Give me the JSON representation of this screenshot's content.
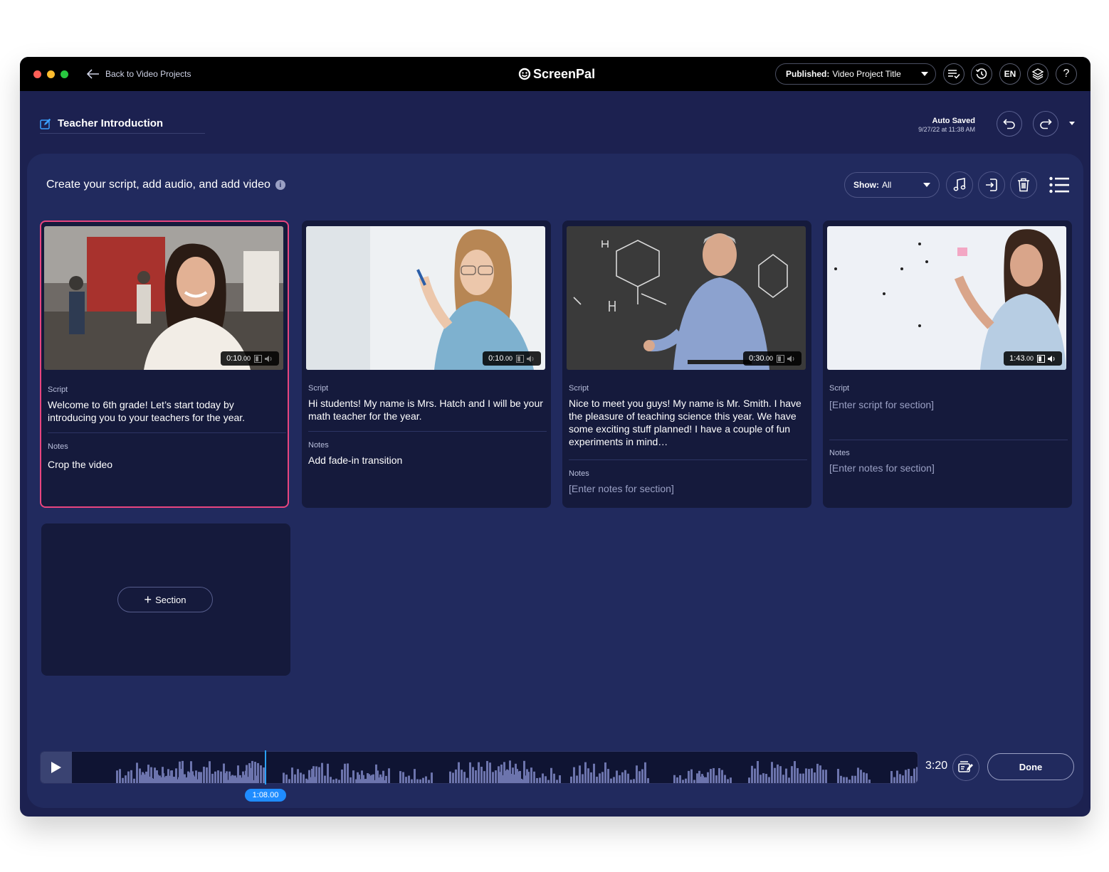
{
  "titlebar": {
    "back_label": "Back to Video Projects",
    "logo_prefix": "Screen",
    "logo_suffix": "Pal",
    "publish_status": "Published:",
    "publish_title": "Video Project Title",
    "language": "EN",
    "help": "?"
  },
  "header": {
    "project_title": "Teacher Introduction",
    "autosave_label": "Auto Saved",
    "autosave_time": "9/27/22 at 11:38 AM"
  },
  "panel": {
    "title": "Create your script, add audio, and add video",
    "info": "i",
    "show_label": "Show:",
    "show_value": "All"
  },
  "cards": [
    {
      "duration_main": "0:10",
      "duration_frac": ".00",
      "script_label": "Script",
      "script": "Welcome to 6th grade! Let’s start today by introducing you to your teachers for the year.",
      "notes_label": "Notes",
      "notes": "Crop the video"
    },
    {
      "duration_main": "0:10",
      "duration_frac": ".00",
      "script_label": "Script",
      "script": "Hi students! My name is Mrs. Hatch and I will be your math teacher for the year.",
      "notes_label": "Notes",
      "notes": "Add fade-in transition"
    },
    {
      "duration_main": "0:30",
      "duration_frac": ".00",
      "script_label": "Script",
      "script": "Nice to meet you guys! My name is Mr. Smith. I have the pleasure of teaching science this year. We have some exciting stuff planned! I have a couple of fun experiments in mind…",
      "notes_label": "Notes",
      "notes": "[Enter notes for section]"
    },
    {
      "duration_main": "1:43",
      "duration_frac": ".00",
      "script_label": "Script",
      "script": "[Enter script for section]",
      "notes_label": "Notes",
      "notes": "[Enter notes for section]"
    }
  ],
  "add_section": {
    "plus": "+",
    "label": "Section"
  },
  "timeline": {
    "playhead_time": "1:08.00",
    "total_time": "3:20",
    "done_label": "Done",
    "playhead_fraction": 0.34
  },
  "colors": {
    "accent_pink": "#e8457f",
    "accent_blue": "#1f8cff",
    "panel_bg": "#212a5e",
    "card_bg": "#151a3c"
  }
}
